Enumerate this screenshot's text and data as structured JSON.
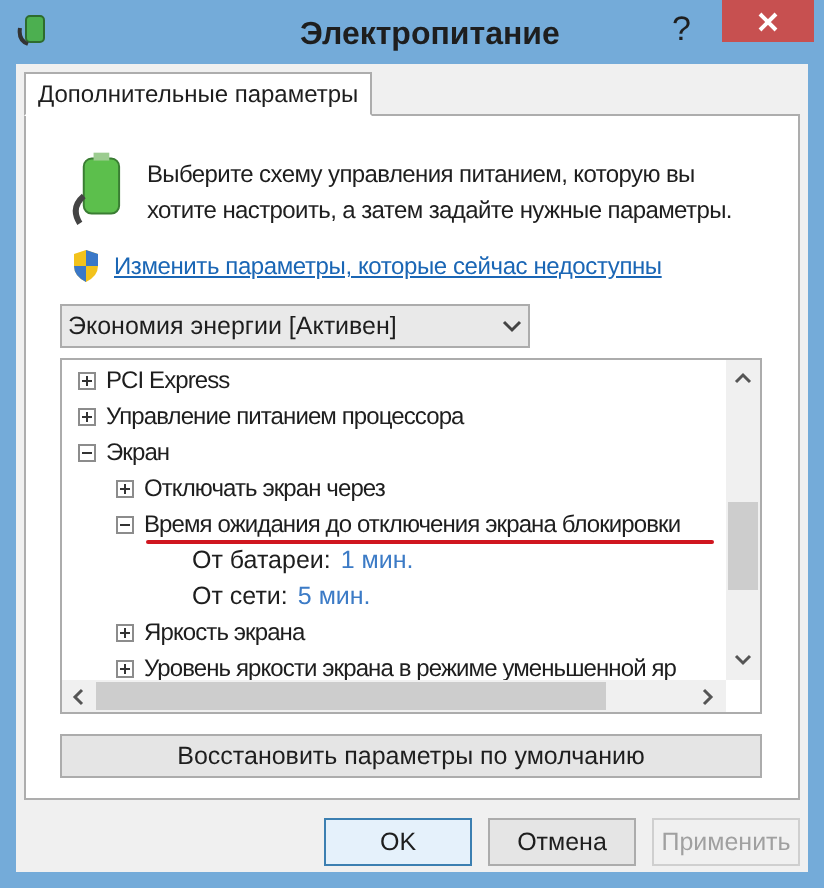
{
  "window": {
    "title": "Электропитание",
    "help": "?"
  },
  "tabs": [
    {
      "label": "Дополнительные параметры",
      "selected": true
    }
  ],
  "description": "Выберите схему управления питанием, которую вы хотите настроить, а затем задайте нужные параметры.",
  "link": "Изменить параметры, которые сейчас недоступны",
  "plan_select": {
    "value": "Экономия энергии [Активен]"
  },
  "tree": [
    {
      "label": "PCI Express",
      "expanded": false
    },
    {
      "label": "Управление питанием процессора",
      "expanded": false
    },
    {
      "label": "Экран",
      "expanded": true,
      "children": [
        {
          "label": "Отключать экран через",
          "expanded": false
        },
        {
          "label": "Время ожидания до отключения экрана блокировки",
          "expanded": true,
          "settings": [
            {
              "label": "От батареи:",
              "value": "1 мин."
            },
            {
              "label": "От сети:",
              "value": "5 мин."
            }
          ]
        },
        {
          "label": "Яркость экрана",
          "expanded": false
        },
        {
          "label": "Уровень яркости экрана в режиме уменьшенной яр",
          "expanded": false
        }
      ]
    }
  ],
  "restore_button": "Восстановить параметры по умолчанию",
  "buttons": [
    {
      "label": "OK",
      "default": true,
      "disabled": false
    },
    {
      "label": "Отмена",
      "default": false,
      "disabled": false
    },
    {
      "label": "Применить",
      "default": false,
      "disabled": true
    }
  ]
}
